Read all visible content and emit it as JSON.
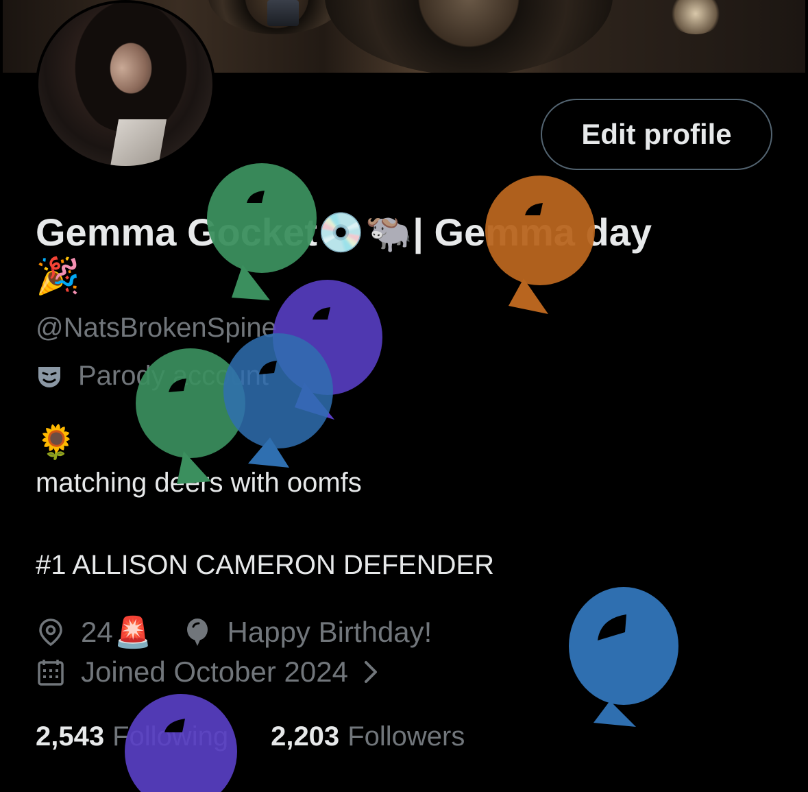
{
  "profile": {
    "display_name": "Gemma Gocket💿🐃| Gemma day",
    "name_emoji": "🎉",
    "handle": "@NatsBrokenSpine",
    "label": "Parody account",
    "bio_emoji": "🌻",
    "bio_line1": "matching deers with oomfs",
    "bio_line2": "#1 ALLISON CAMERON DEFENDER",
    "location": "24",
    "location_emoji": "🚨",
    "birthday": "Happy Birthday!",
    "joined": "Joined October 2024",
    "following_count": "2,543",
    "following_label": "Following",
    "followers_count": "2,203",
    "followers_label": "Followers"
  },
  "actions": {
    "edit_profile": "Edit profile"
  },
  "icons": [
    "parody-mask-icon",
    "location-pin-icon",
    "balloon-icon",
    "calendar-icon",
    "chevron-right-icon"
  ],
  "colors": {
    "background": "#000000",
    "primary_text": "#e7e9ea",
    "secondary_text": "#71767b",
    "button_border": "#536471",
    "balloon_green": "#3b8f5e",
    "balloon_orange": "#b8651f",
    "balloon_purple": "#5a40c8",
    "balloon_blue": "#2f6fb0"
  }
}
